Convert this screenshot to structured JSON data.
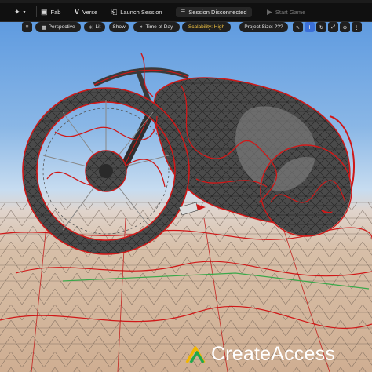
{
  "toolbar": {
    "fab": "Fab",
    "verse": "Verse",
    "launch_session": "Launch Session",
    "session_status": "Session Disconnected",
    "start_game": "Start Game"
  },
  "viewport_toolbar": {
    "perspective": "Perspective",
    "lit": "Lit",
    "show": "Show",
    "time_of_day": "Time of Day",
    "scalability": "Scalability: High",
    "project_size": "Project Size: ???"
  },
  "icons": [
    "add-content-icon",
    "fab-icon",
    "verse-icon",
    "launch-session-icon",
    "session-icon",
    "play-icon",
    "menu-icon",
    "perspective-icon",
    "lit-icon",
    "time-icon",
    "select-icon",
    "move-icon",
    "rotate-icon",
    "scale-icon",
    "world-icon",
    "snap-icon"
  ],
  "accent_colors": {
    "wireframe": "#e01010",
    "scalability": "#f4c542",
    "active_tool": "#3a6fd8",
    "logo_green": "#22a84a",
    "logo_yellow": "#f2b600"
  },
  "watermark": {
    "text": "CreateAccess"
  }
}
